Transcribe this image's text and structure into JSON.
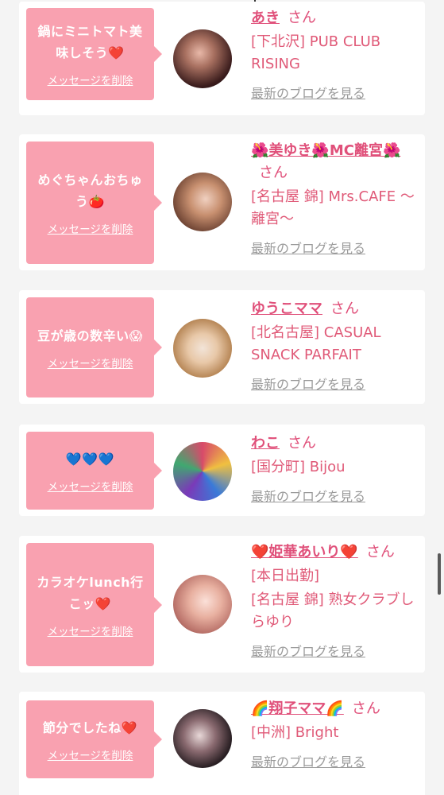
{
  "common": {
    "san_label": "さん",
    "delete_label": "メッセージを削除",
    "blog_label": "最新のブログを見る"
  },
  "entries": [
    {
      "message": "鍋にミニトマト美味しそう❤️",
      "name": "あき",
      "status": "",
      "shop": "[下北沢] PUB CLUB RISING"
    },
    {
      "message": "めぐちゃんおちゅう🍅",
      "name": "🌺美ゆき🌺MC離宮🌺",
      "status": "",
      "shop": "[名古屋 錦] Mrs.CAFE ～離宮～"
    },
    {
      "message": "豆が歳の数辛い😱",
      "name": "ゆうこママ",
      "status": "",
      "shop": "[北名古屋] CASUAL SNACK PARFAIT"
    },
    {
      "message": "💙💙💙",
      "name": "わこ",
      "status": "",
      "shop": "[国分町] Bijou"
    },
    {
      "message": "カラオケlunch行こッ❤️",
      "name": "❤️姫華あいり❤️",
      "status": "[本日出勤]",
      "shop": "[名古屋 錦] 熟女クラブしらゆり"
    },
    {
      "message": "節分でしたね❤️",
      "name": "🌈翔子ママ🌈",
      "status": "",
      "shop": "[中洲] Bright"
    }
  ],
  "colors": {
    "bubble": "#f9a1b0",
    "name": "#e0507a",
    "shop": "#e05a78",
    "blog": "#9a9a9a",
    "background": "#f4f4f4"
  }
}
